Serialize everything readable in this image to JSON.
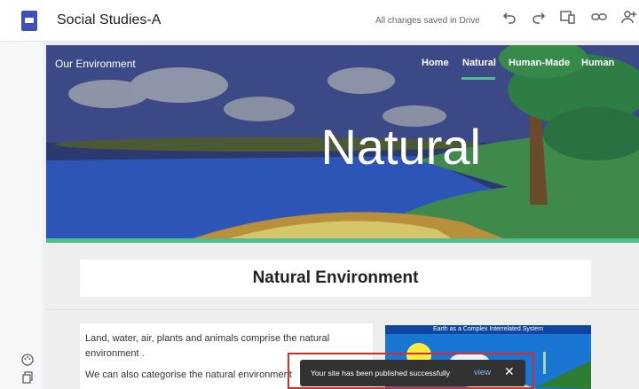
{
  "topbar": {
    "title": "Social Studies-A",
    "status": "All changes saved in Drive",
    "icons": [
      "undo-icon",
      "redo-icon",
      "preview-icon",
      "link-icon",
      "share-icon"
    ]
  },
  "site": {
    "name": "Our Environment",
    "nav": [
      "Home",
      "Natural",
      "Human-Made",
      "Human"
    ],
    "active_nav": "Natural",
    "hero_title": "Natural"
  },
  "section": {
    "title": "Natural Environment"
  },
  "content": {
    "paragraphs": [
      "Land, water, air, plants and animals comprise the natural environment .",
      "We can also categorise the natural environment"
    ],
    "image_title": "Earth as a Complex Interrelated System"
  },
  "toast": {
    "message": "Your site has been published successfully",
    "action": "view"
  },
  "colors": {
    "accent": "#4fbd8c",
    "toast_bg": "#323232",
    "highlight": "#d32f2f"
  }
}
